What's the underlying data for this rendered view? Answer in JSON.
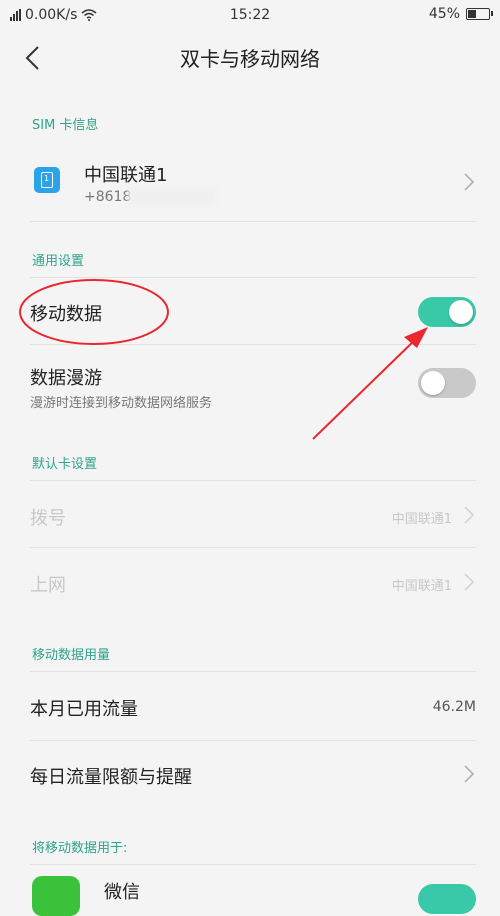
{
  "status": {
    "network_speed": "0.00K/s",
    "time": "15:22",
    "battery": "45%",
    "battery_level": 0.45
  },
  "nav": {
    "title": "双卡与移动网络"
  },
  "sim_section": {
    "header": "SIM 卡信息",
    "sim1": {
      "name": "中国联通1",
      "number_visible": "+8618"
    }
  },
  "general_section": {
    "header": "通用设置",
    "mobile_data": {
      "label": "移动数据",
      "enabled": true
    },
    "roaming": {
      "label": "数据漫游",
      "subtitle": "漫游时连接到移动数据网络服务",
      "enabled": false
    }
  },
  "default_section": {
    "header": "默认卡设置",
    "dial": {
      "label": "拨号",
      "value": "中国联通1"
    },
    "internet": {
      "label": "上网",
      "value": "中国联通1"
    }
  },
  "usage_section": {
    "header": "移动数据用量",
    "monthly": {
      "label": "本月已用流量",
      "value": "46.2M"
    },
    "daily_limit": {
      "label": "每日流量限额与提醒"
    }
  },
  "apps_section": {
    "header": "将移动数据用于:",
    "app1": {
      "label": "微信"
    }
  },
  "colors": {
    "accent": "#2fa38d",
    "toggle_on": "#3ac9a8",
    "toggle_off": "#c9c9c9",
    "annotation": "#e8282e"
  }
}
